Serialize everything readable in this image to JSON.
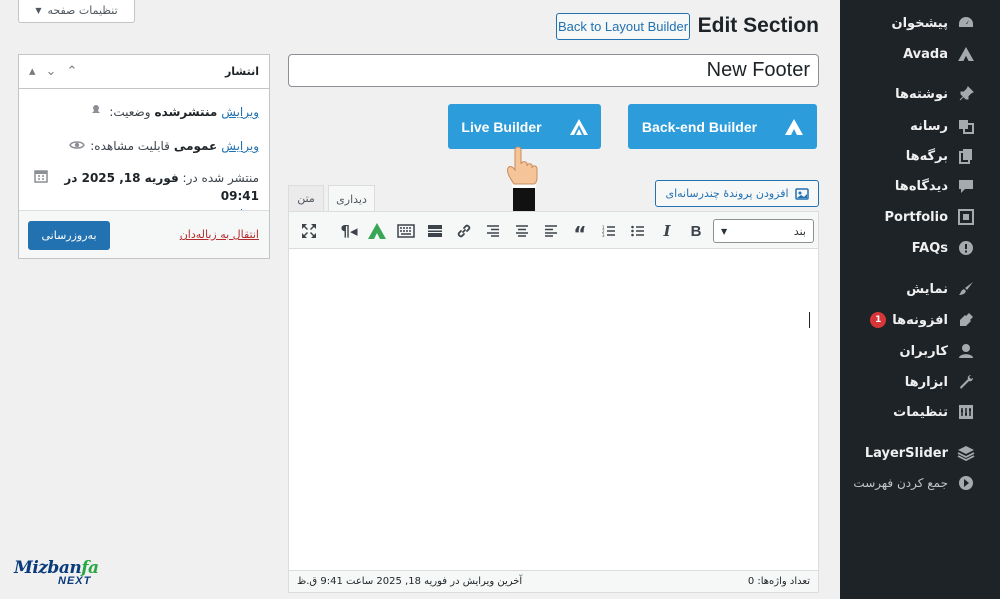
{
  "screen_options": {
    "label": "تنظیمات صفحه"
  },
  "header": {
    "title": "Edit Section",
    "back_label": "Back to Layout Builder"
  },
  "post_title": {
    "value": "New Footer"
  },
  "builders": {
    "live_label": "Live Builder",
    "backend_label": "Back-end Builder"
  },
  "editor": {
    "add_media_label": "افزودن پروندهٔ چندرسانه‌ای",
    "tab_visual": "دیداری",
    "tab_text": "متن",
    "format_value": "بند",
    "word_count": "تعداد واژه‌ها: 0",
    "last_edited": "آخرین ویرایش در فوریه 18, 2025 ساعت 9:41 ق.ظ"
  },
  "publish": {
    "title": "انتشار",
    "status_label": "وضعیت:",
    "status_value": "منتشرشده",
    "visibility_label": "قابلیت مشاهده:",
    "visibility_value": "عمومی",
    "published_label": "منتشر شده در:",
    "published_date": "فوریه 18, 2025 در",
    "published_time": "09:41",
    "edit_link": "ویرایش",
    "trash_link": "انتقال به زباله‌دان",
    "update_label": "به‌روزرسانی"
  },
  "sidebar": {
    "items": [
      {
        "label": "پیشخوان",
        "icon": "dashboard-icon"
      },
      {
        "label": "Avada",
        "icon": "avada-icon"
      },
      {
        "label": "نوشته‌ها",
        "icon": "pin-icon"
      },
      {
        "label": "رسانه",
        "icon": "media-icon"
      },
      {
        "label": "برگه‌ها",
        "icon": "pages-icon"
      },
      {
        "label": "دیدگاه‌ها",
        "icon": "comments-icon"
      },
      {
        "label": "Portfolio",
        "icon": "portfolio-icon"
      },
      {
        "label": "FAQs",
        "icon": "info-icon"
      },
      {
        "label": "نمایش",
        "icon": "brush-icon"
      },
      {
        "label": "افزونه‌ها",
        "icon": "plugin-icon",
        "badge": "1"
      },
      {
        "label": "کاربران",
        "icon": "user-icon"
      },
      {
        "label": "ابزارها",
        "icon": "wrench-icon"
      },
      {
        "label": "تنظیمات",
        "icon": "settings-icon"
      },
      {
        "label": "LayerSlider",
        "icon": "layers-icon"
      },
      {
        "label": "جمع کردن فهرست",
        "icon": "collapse-icon"
      }
    ]
  },
  "watermark": {
    "brand_main": "Mizban",
    "brand_accent": "fa",
    "brand_sub": "NEXT"
  },
  "colors": {
    "sidebar_bg": "#1d2327",
    "accent": "#2271b1",
    "builder_blue": "#2d9cdb",
    "badge_red": "#d63638"
  }
}
